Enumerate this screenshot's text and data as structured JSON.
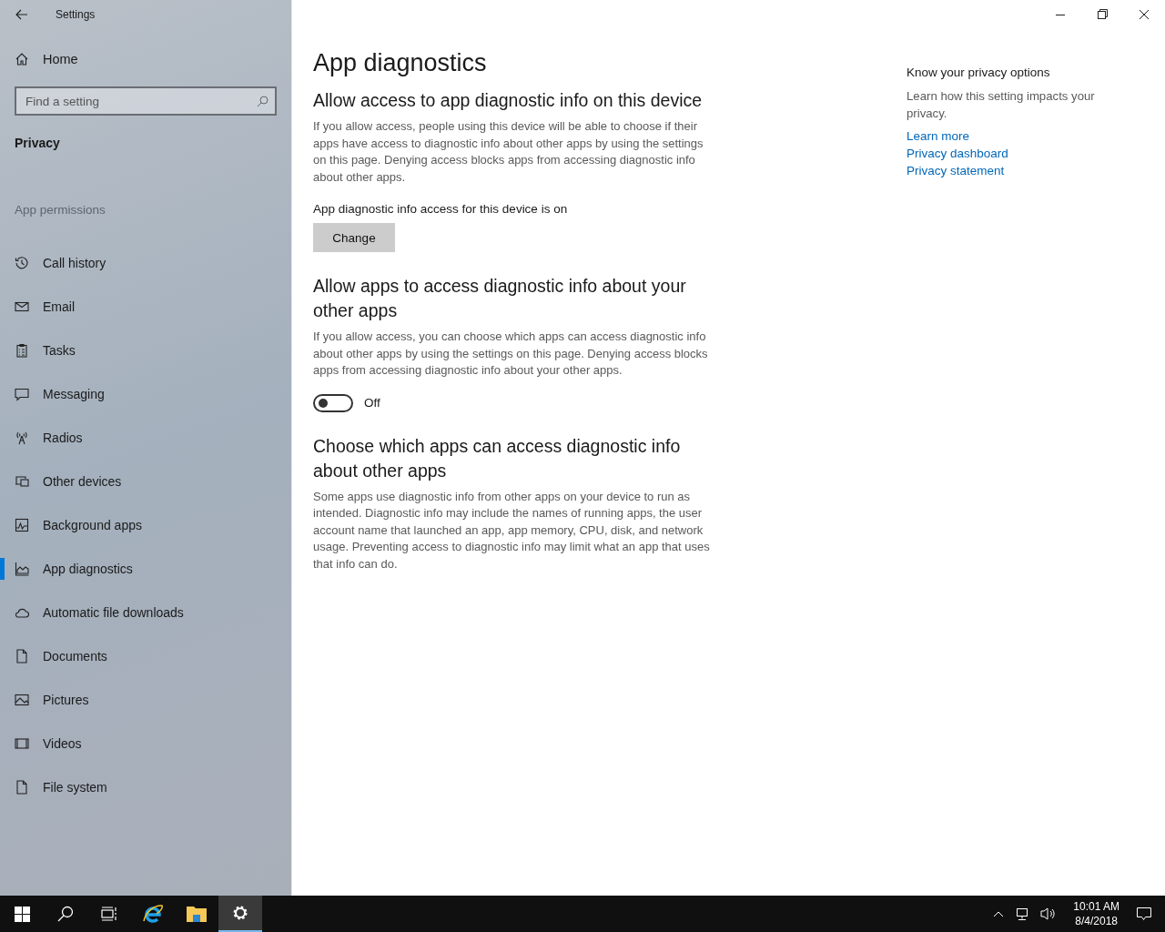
{
  "window": {
    "title": "Settings"
  },
  "sidebar": {
    "home": "Home",
    "search": {
      "placeholder": "Find a setting"
    },
    "section": "Privacy",
    "group": "App permissions",
    "items": [
      {
        "label": "Call history",
        "selected": false
      },
      {
        "label": "Email",
        "selected": false
      },
      {
        "label": "Tasks",
        "selected": false
      },
      {
        "label": "Messaging",
        "selected": false
      },
      {
        "label": "Radios",
        "selected": false
      },
      {
        "label": "Other devices",
        "selected": false
      },
      {
        "label": "Background apps",
        "selected": false
      },
      {
        "label": "App diagnostics",
        "selected": true
      },
      {
        "label": "Automatic file downloads",
        "selected": false
      },
      {
        "label": "Documents",
        "selected": false
      },
      {
        "label": "Pictures",
        "selected": false
      },
      {
        "label": "Videos",
        "selected": false
      },
      {
        "label": "File system",
        "selected": false
      }
    ]
  },
  "page": {
    "title": "App diagnostics",
    "sections": [
      {
        "kind": "button",
        "heading": "Allow access to app diagnostic info on this device",
        "text": "If you allow access, people using this device will be able to choose if their apps have access to diagnostic info about other apps by using the settings on this page. Denying access blocks apps from accessing diagnostic info about other apps.",
        "status": "App diagnostic info access for this device is on",
        "button": "Change"
      },
      {
        "kind": "toggle",
        "heading": "Allow apps to access diagnostic info about your other apps",
        "text": "If you allow access, you can choose which apps can access diagnostic info about other apps by using the settings on this page. Denying access blocks apps from accessing diagnostic info about your other apps.",
        "on": false,
        "toggle_label": "Off"
      },
      {
        "kind": "text",
        "heading": "Choose which apps can access diagnostic info about other apps",
        "text": "Some apps use diagnostic info from other apps on your device to run as intended. Diagnostic info may include the names of running apps, the user account name that launched an app, app memory, CPU, disk, and network usage. Preventing access to diagnostic info may limit what an app that uses that info can do."
      }
    ]
  },
  "aside": {
    "heading": "Know your privacy options",
    "text": "Learn how this setting impacts your privacy.",
    "links": [
      "Learn more",
      "Privacy dashboard",
      "Privacy statement"
    ]
  },
  "taskbar": {
    "time": "10:01 AM",
    "date": "8/4/2018"
  }
}
